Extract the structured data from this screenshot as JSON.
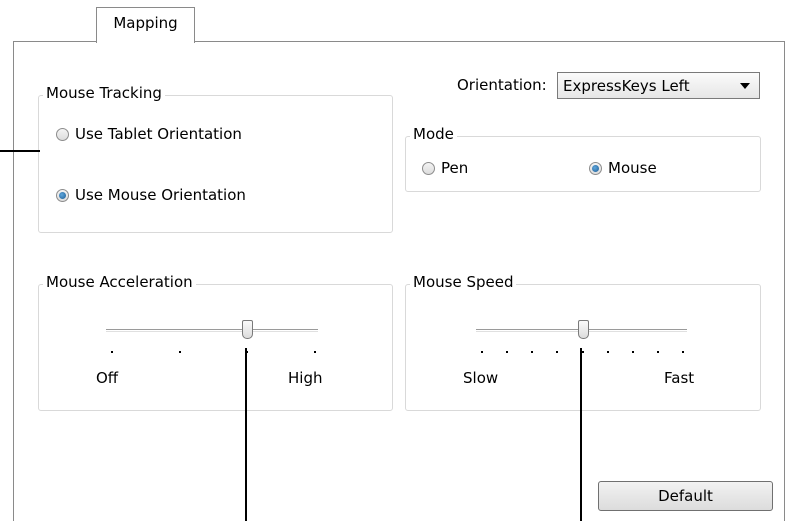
{
  "tabs": [
    {
      "label": "Mapping"
    }
  ],
  "orientation": {
    "label": "Orientation:",
    "value": "ExpressKeys Left"
  },
  "mouse_tracking": {
    "title": "Mouse Tracking",
    "options": [
      {
        "label": "Use Tablet Orientation",
        "selected": false
      },
      {
        "label": "Use Mouse Orientation",
        "selected": true
      }
    ]
  },
  "mode": {
    "title": "Mode",
    "options": [
      {
        "label": "Pen",
        "selected": false
      },
      {
        "label": "Mouse",
        "selected": true
      }
    ]
  },
  "mouse_acceleration": {
    "title": "Mouse Acceleration",
    "min_label": "Off",
    "max_label": "High",
    "stops": 4,
    "value_index": 2
  },
  "mouse_speed": {
    "title": "Mouse Speed",
    "min_label": "Slow",
    "max_label": "Fast",
    "stops": 9,
    "value_index": 4
  },
  "default_button": {
    "label": "Default"
  },
  "colors": {
    "radio_selected": "#1d5c93",
    "border": "#8a8a8a"
  },
  "icons": [
    "dropdown-caret-icon"
  ]
}
